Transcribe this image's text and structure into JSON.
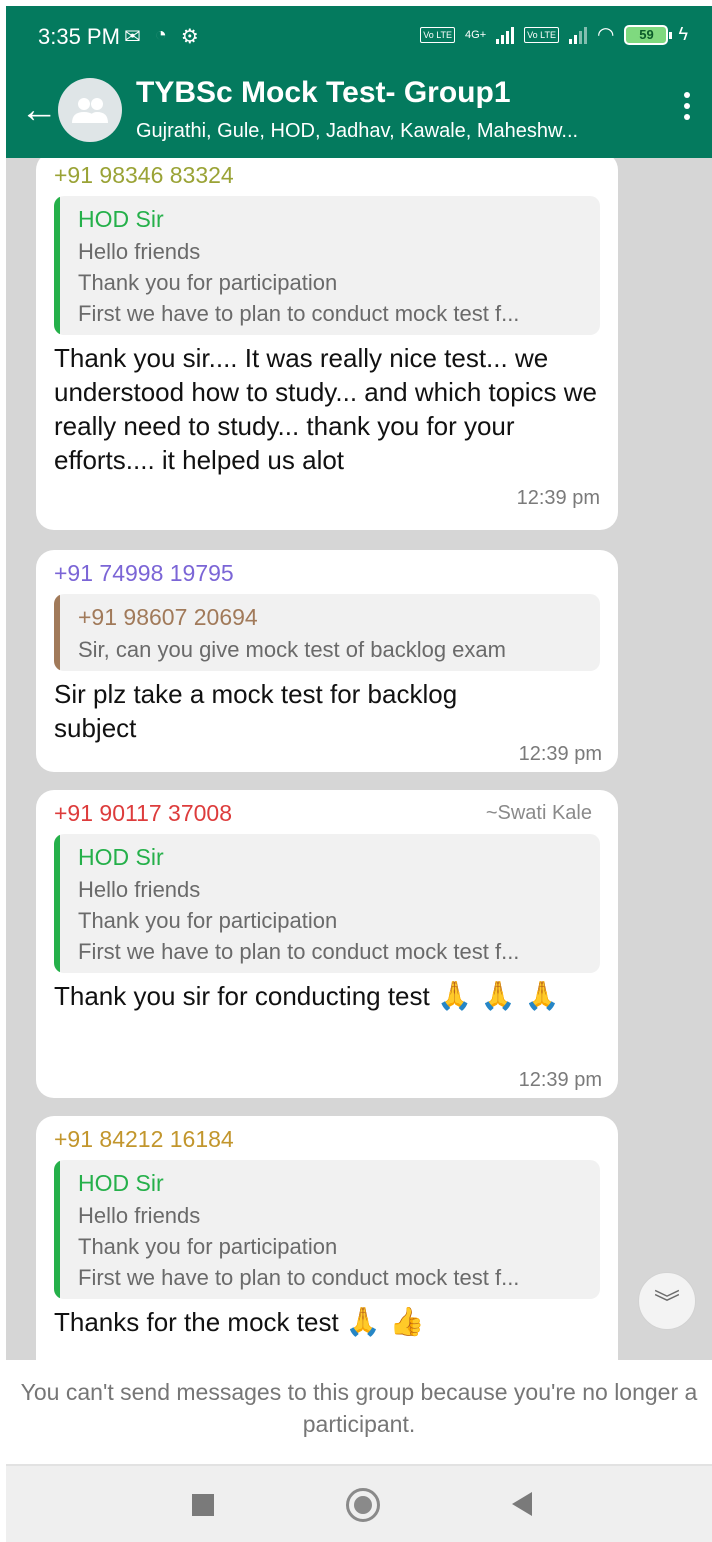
{
  "status_bar": {
    "time": "3:35 PM",
    "icons": [
      "mail-icon",
      "data-saver-icon",
      "settings-icon",
      "volte-icon",
      "signal-icon",
      "wifi-icon",
      "battery-icon",
      "charging-icon"
    ],
    "network_type": "4G+",
    "volte_label": "Vo LTE",
    "battery_level": "59"
  },
  "header": {
    "title": "TYBSc Mock Test- Group1",
    "subtitle": "Gujrathi, Gule, HOD, Jadhav, Kawale, Maheshw...",
    "color": "#047a5e"
  },
  "messages": [
    {
      "sender": "+91 98346 83324",
      "sender_color": "#9aa336",
      "quote": {
        "author": "HOD Sir",
        "author_color": "#25b04a",
        "lines": [
          "Hello friends",
          "Thank you for participation",
          "First we have to plan to conduct mock test f..."
        ]
      },
      "text": "Thank you sir.... It was really nice test... we understood how to study... and which topics we really need to study... thank you for your efforts.... it helped us alot",
      "time": "12:39 pm"
    },
    {
      "sender": "+91 74998 19795",
      "sender_color": "#7b65d6",
      "quote": {
        "author": "+91 98607 20694",
        "author_color": "#a17a5a",
        "lines": [
          "Sir, can you give mock test of backlog exam"
        ]
      },
      "text": "Sir plz take a mock test for backlog subject",
      "time": "12:39 pm"
    },
    {
      "sender": "+91 90117 37008",
      "sender_color": "#dd3c3c",
      "push_name": "~Swati Kale",
      "quote": {
        "author": "HOD Sir",
        "author_color": "#25b04a",
        "lines": [
          "Hello friends",
          "Thank you for participation",
          "First we have to plan to conduct mock test f..."
        ]
      },
      "text": "Thank you sir for conducting test",
      "emoji": "🙏 🙏 🙏",
      "time": "12:39 pm"
    },
    {
      "sender": "+91 84212 16184",
      "sender_color": "#c2962d",
      "quote": {
        "author": "HOD Sir",
        "author_color": "#25b04a",
        "lines": [
          "Hello friends",
          "Thank you for participation",
          "First we have to plan to conduct mock test f..."
        ]
      },
      "text": "Thanks for the mock test",
      "emoji": "🙏 👍"
    }
  ],
  "scroll_down_icon": "double-chevron-down-icon",
  "notice": "You can't send messages to this group because you're no longer a participant.",
  "nav": [
    "recents-icon",
    "home-icon",
    "back-icon"
  ]
}
